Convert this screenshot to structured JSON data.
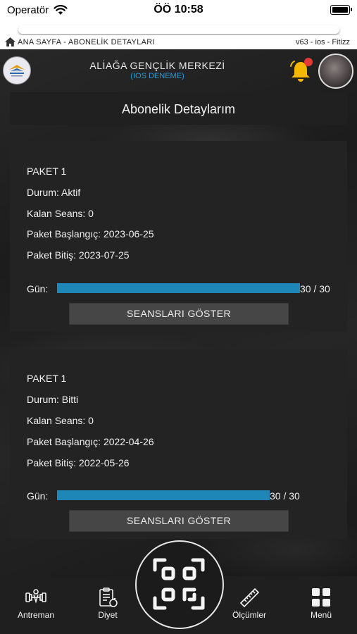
{
  "status_bar": {
    "carrier": "Operatör",
    "time": "ÖÖ 10:58"
  },
  "breadcrumb": {
    "path": "ANA SAYFA - ABONELİK DETAYLARI",
    "version": "v63 - ios -  Fitizz"
  },
  "header": {
    "club_name": "ALİAĞA GENÇLİK MERKEZİ",
    "subtitle": "(IOS DENEME)",
    "has_notification": true
  },
  "page": {
    "title": "Abonelik Detaylarım"
  },
  "packages": [
    {
      "name": "PAKET 1",
      "status": "Durum: Aktif",
      "remaining": "Kalan Seans: 0",
      "start": "Paket Başlangıç: 2023-06-25",
      "end": "Paket Bitiş: 2023-07-25",
      "progress_label": "Gün:",
      "progress_text": "30 / 30",
      "progress_fraction": 1.0,
      "button_label": "SEANSLARI GÖSTER"
    },
    {
      "name": "PAKET 1",
      "status": "Durum: Bitti",
      "remaining": "Kalan Seans: 0",
      "start": "Paket Başlangıç: 2022-04-26",
      "end": "Paket Bitiş: 2022-05-26",
      "progress_label": "Gün:",
      "progress_text": "30 / 30",
      "progress_fraction": 1.0,
      "button_label": "SEANSLARI GÖSTER"
    }
  ],
  "nav": {
    "items": [
      {
        "label": "Antreman",
        "icon": "dumbbell-icon"
      },
      {
        "label": "Diyet",
        "icon": "diet-clipboard-icon"
      },
      {
        "label": "Ölçümler",
        "icon": "ruler-icon"
      },
      {
        "label": "Menü",
        "icon": "grid-menu-icon"
      }
    ],
    "center_icon": "qr-scan-icon"
  },
  "colors": {
    "accent": "#1f86b8",
    "subtitle": "#2b9ad8",
    "bell": "#f5b800",
    "badge": "#e53935"
  }
}
